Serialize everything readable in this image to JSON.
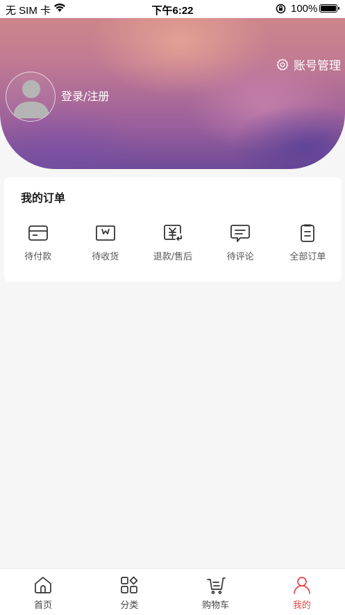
{
  "status_bar": {
    "carrier": "无 SIM 卡",
    "time": "下午6:22",
    "battery": "100%"
  },
  "header": {
    "account_management": "账号管理",
    "login_register": "登录/注册"
  },
  "orders": {
    "title": "我的订单",
    "items": [
      {
        "label": "待付款",
        "icon": "wallet-card-icon"
      },
      {
        "label": "待收货",
        "icon": "package-receive-icon"
      },
      {
        "label": "退款/售后",
        "icon": "refund-icon"
      },
      {
        "label": "待评论",
        "icon": "comment-icon"
      },
      {
        "label": "全部订单",
        "icon": "order-list-icon"
      }
    ]
  },
  "tabbar": {
    "active_color": "#e64545",
    "items": [
      {
        "label": "首页",
        "icon": "home-icon",
        "active": false
      },
      {
        "label": "分类",
        "icon": "category-icon",
        "active": false
      },
      {
        "label": "购物车",
        "icon": "cart-icon",
        "active": false
      },
      {
        "label": "我的",
        "icon": "user-icon",
        "active": true
      }
    ]
  }
}
